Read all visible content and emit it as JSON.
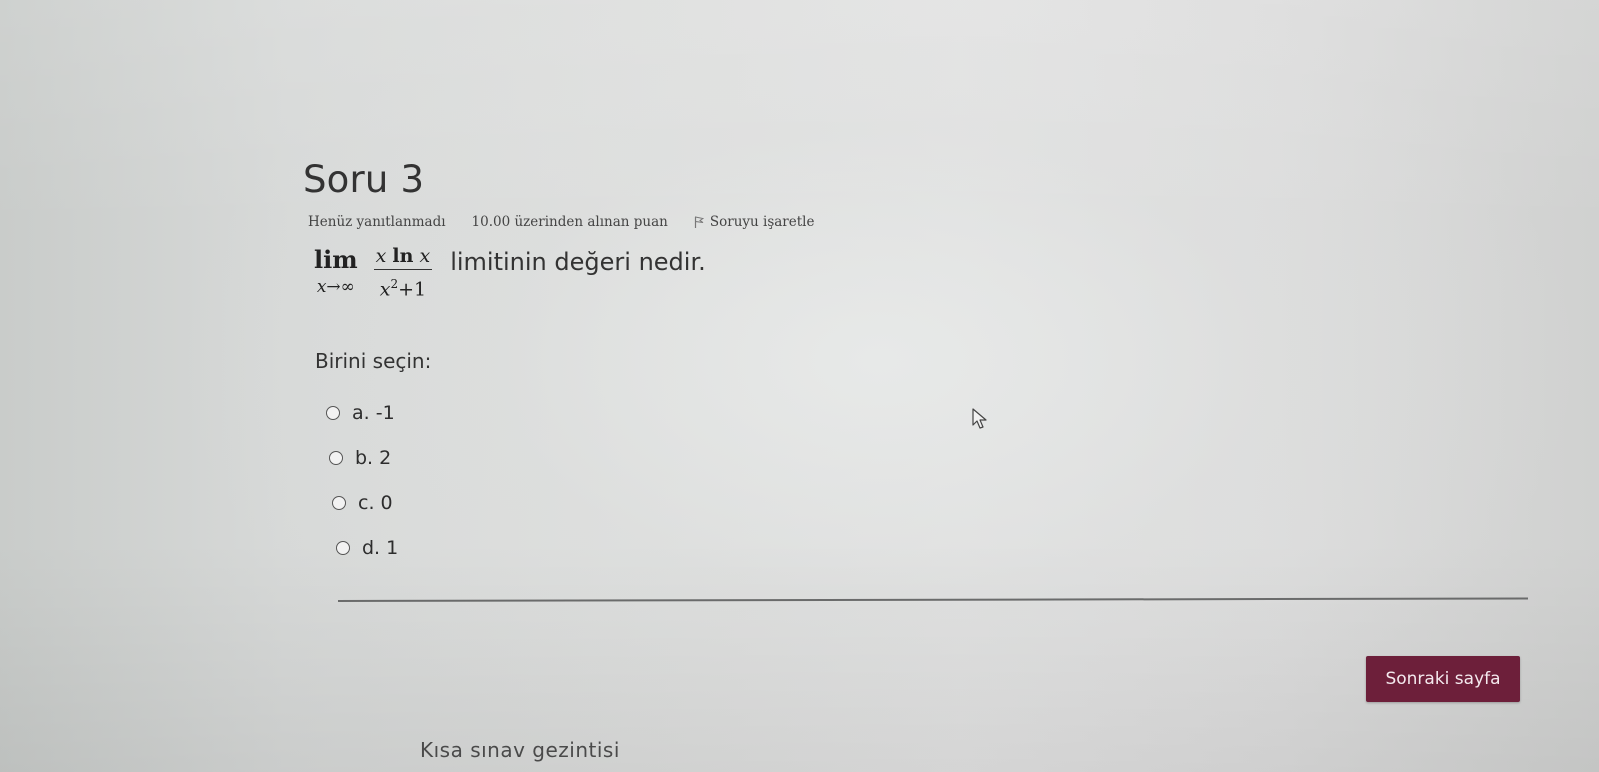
{
  "question": {
    "title": "Soru 3",
    "status": "Henüz yanıtlanmadı",
    "points": "10.00 üzerinden alınan puan",
    "flag_label": "Soruyu işaretle",
    "math": {
      "lim_word": "lim",
      "lim_sub": "x→∞",
      "numerator_x": "x",
      "numerator_ln": "ln",
      "numerator_x2": "x",
      "denominator_x": "x",
      "denominator_exp": "2",
      "denominator_rest": "+1"
    },
    "text_suffix": "limitinin değeri nedir.",
    "prompt": "Birini seçin:",
    "options": [
      {
        "label": "a. -1"
      },
      {
        "label": "b. 2"
      },
      {
        "label": "c. 0"
      },
      {
        "label": "d. 1"
      }
    ]
  },
  "footer": {
    "next_label": "Sonraki sayfa",
    "quiz_nav_label": "Kısa sınav gezintisi"
  },
  "colors": {
    "next_button_bg": "#6d1f3a",
    "divider": "#6a6b6b"
  },
  "icons": {
    "flag": "flag-icon",
    "radio": "radio-icon",
    "cursor": "mouse-pointer-icon"
  }
}
